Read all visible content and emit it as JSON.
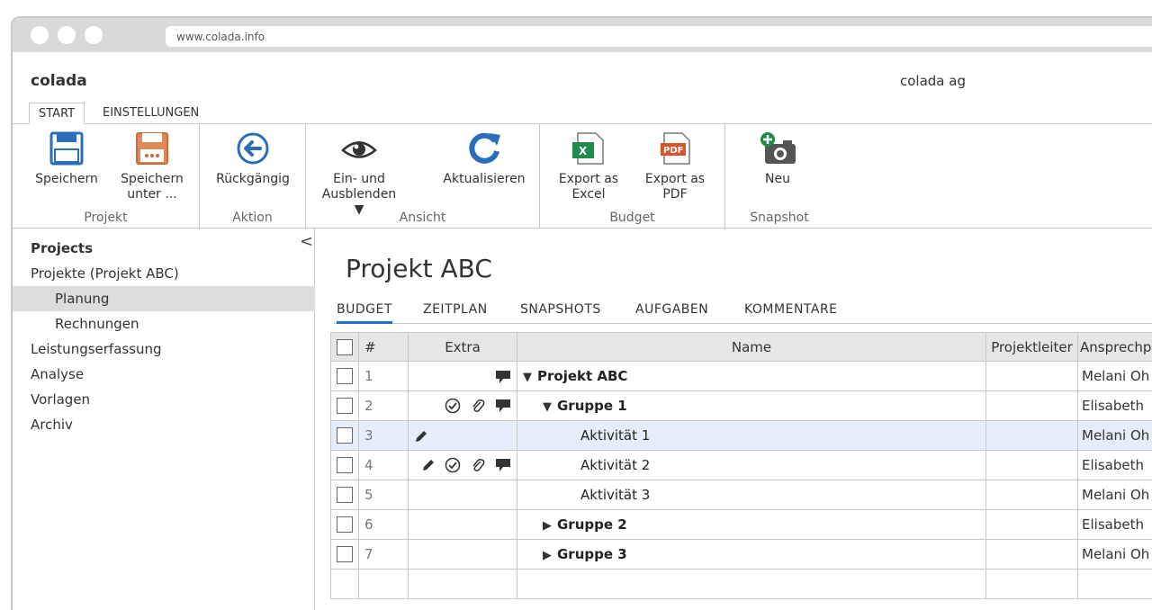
{
  "browser": {
    "url": "www.colada.info"
  },
  "app": {
    "name": "colada",
    "company": "colada ag"
  },
  "tabs": [
    {
      "label": "START",
      "active": true
    },
    {
      "label": "EINSTELLUNGEN",
      "active": false
    }
  ],
  "ribbon": {
    "groups": [
      {
        "label": "Projekt",
        "buttons": [
          {
            "label": "Speichern",
            "icon": "save-icon"
          },
          {
            "label": "Speichern\nunter ...",
            "icon": "save-as-icon"
          }
        ]
      },
      {
        "label": "Aktion",
        "buttons": [
          {
            "label": "Rückgängig",
            "icon": "undo-icon"
          }
        ]
      },
      {
        "label": "Ansicht",
        "buttons": [
          {
            "label": "Ein- und\nAusblenden ▼",
            "icon": "eye-icon"
          },
          {
            "label": "Aktualisieren",
            "icon": "refresh-icon"
          }
        ]
      },
      {
        "label": "Budget",
        "buttons": [
          {
            "label": "Export as\nExcel",
            "icon": "excel-icon"
          },
          {
            "label": "Export as\nPDF",
            "icon": "pdf-icon"
          }
        ]
      },
      {
        "label": "Snapshot",
        "buttons": [
          {
            "label": "Neu",
            "icon": "camera-add-icon"
          }
        ]
      }
    ]
  },
  "sidebar": {
    "items": [
      {
        "label": "Projects"
      },
      {
        "label": "Projekte (Projekt ABC)"
      },
      {
        "label": "Planung"
      },
      {
        "label": "Rechnungen"
      },
      {
        "label": "Leistungserfassung"
      },
      {
        "label": "Analyse"
      },
      {
        "label": "Vorlagen"
      },
      {
        "label": "Archiv"
      }
    ],
    "collapse_glyph": "<"
  },
  "main": {
    "title": "Projekt ABC",
    "tabs": [
      "BUDGET",
      "ZEITPLAN",
      "SNAPSHOTS",
      "AUFGABEN",
      "KOMMENTARE"
    ],
    "table": {
      "headers": {
        "num": "#",
        "extra": "Extra",
        "name": "Name",
        "projektleiter": "Projektleiter",
        "ansprechpartner": "Ansprechp"
      },
      "rows": [
        {
          "num": "1",
          "name": "Projekt ABC",
          "ansprech": "Melani Oh"
        },
        {
          "num": "2",
          "name": "Gruppe 1",
          "ansprech": "Elisabeth"
        },
        {
          "num": "3",
          "name": "Aktivität 1",
          "ansprech": "Melani Oh"
        },
        {
          "num": "4",
          "name": "Aktivität 2",
          "ansprech": "Elisabeth"
        },
        {
          "num": "5",
          "name": "Aktivität 3",
          "ansprech": "Melani Oh"
        },
        {
          "num": "6",
          "name": "Gruppe 2",
          "ansprech": "Elisabeth"
        },
        {
          "num": "7",
          "name": "Gruppe 3",
          "ansprech": "Melani Oh"
        }
      ]
    }
  },
  "colors": {
    "accent": "#1a73c8",
    "selected_row": "#e3eefa",
    "sidebar_selected": "#dcdcdc"
  }
}
